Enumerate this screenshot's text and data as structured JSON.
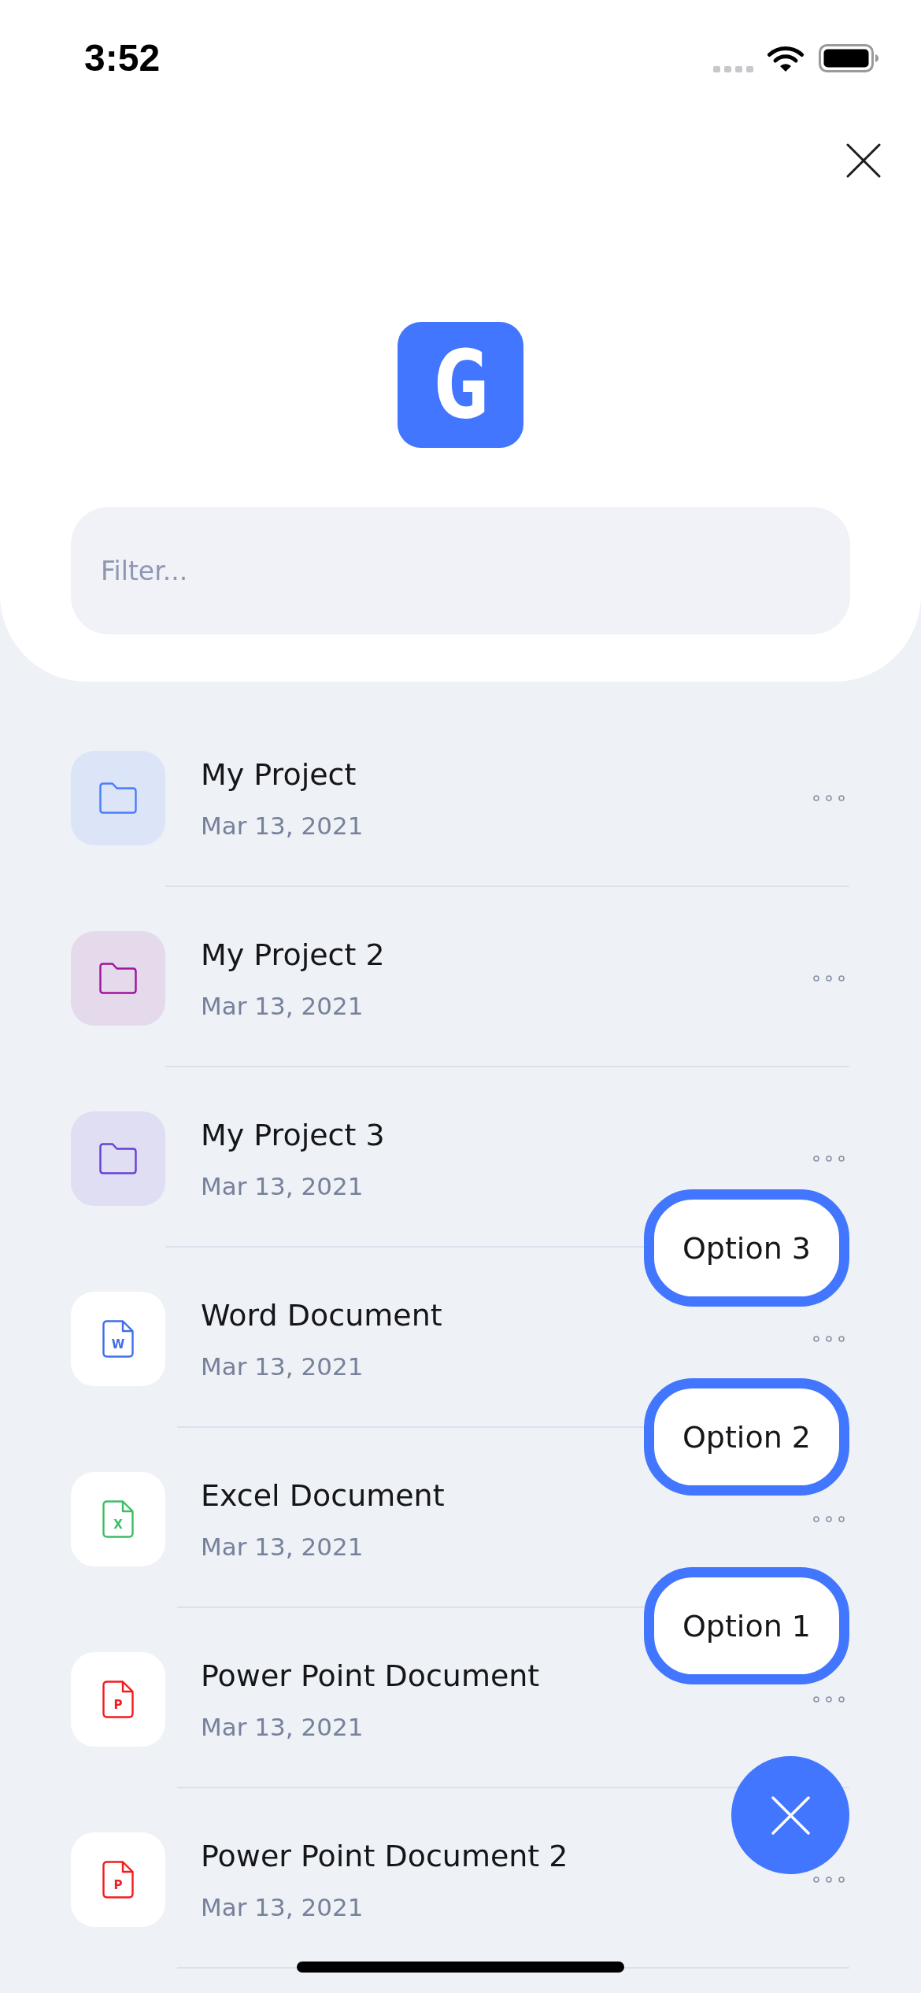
{
  "status_bar": {
    "time": "3:52"
  },
  "header": {
    "logo": "G",
    "filter": {
      "placeholder": "Filter..."
    }
  },
  "items": [
    {
      "kind": "folder",
      "title": "My Project",
      "date": "Mar 13, 2021",
      "color": "#4a7cfb"
    },
    {
      "kind": "folder",
      "title": "My Project 2",
      "date": "Mar 13, 2021",
      "color": "#a0139c"
    },
    {
      "kind": "folder",
      "title": "My Project 3",
      "date": "Mar 13, 2021",
      "color": "#6541d6"
    },
    {
      "kind": "document",
      "icon_letter": "W",
      "title": "Word Document",
      "date": "Mar 13, 2021",
      "color": "#3f6fe8"
    },
    {
      "kind": "document",
      "icon_letter": "X",
      "title": "Excel Document",
      "date": "Mar 13, 2021",
      "color": "#3dbd66"
    },
    {
      "kind": "document",
      "icon_letter": "P",
      "title": "Power Point Document",
      "date": "Mar 13, 2021",
      "color": "#f21c1c"
    },
    {
      "kind": "document",
      "icon_letter": "P",
      "title": "Power Point Document 2",
      "date": "Mar 13, 2021",
      "color": "#f21c1c"
    }
  ],
  "speed_dial": {
    "expanded": true,
    "options": [
      {
        "label": "Option 3"
      },
      {
        "label": "Option 2"
      },
      {
        "label": "Option 1"
      }
    ]
  }
}
